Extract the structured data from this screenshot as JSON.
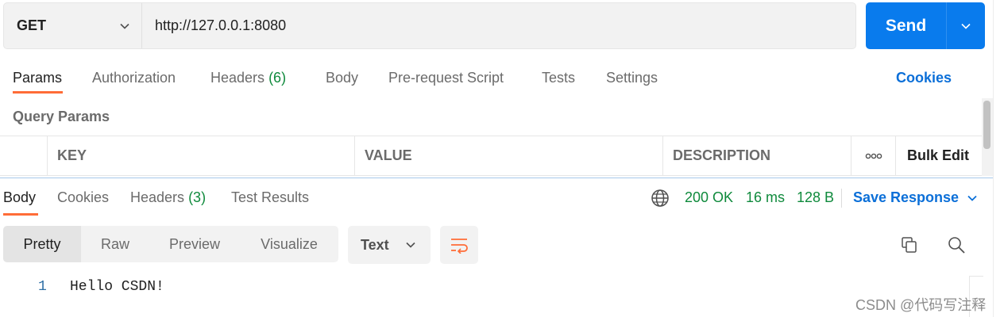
{
  "request": {
    "method": "GET",
    "url": "http://127.0.0.1:8080",
    "send_label": "Send"
  },
  "request_tabs": [
    {
      "label": "Params",
      "active": true
    },
    {
      "label": "Authorization"
    },
    {
      "label": "Headers",
      "count": "(6)"
    },
    {
      "label": "Body"
    },
    {
      "label": "Pre-request Script"
    },
    {
      "label": "Tests"
    },
    {
      "label": "Settings"
    }
  ],
  "cookies_link": "Cookies",
  "query_params": {
    "title": "Query Params",
    "columns": [
      "KEY",
      "VALUE",
      "DESCRIPTION"
    ],
    "more_icon_label": "ooo",
    "bulk_edit": "Bulk Edit"
  },
  "response_tabs": [
    {
      "label": "Body",
      "active": true
    },
    {
      "label": "Cookies"
    },
    {
      "label": "Headers",
      "count": "(3)"
    },
    {
      "label": "Test Results"
    }
  ],
  "response_status": {
    "status": "200 OK",
    "time": "16 ms",
    "size": "128 B",
    "save_label": "Save Response"
  },
  "view_modes": [
    "Pretty",
    "Raw",
    "Preview",
    "Visualize"
  ],
  "format": "Text",
  "body": {
    "line_number": "1",
    "content": "Hello CSDN!"
  },
  "watermark": "CSDN @代码写注释",
  "colors": {
    "accent": "#ff6c37",
    "send": "#097bed",
    "link": "#0b6fd8",
    "success": "#0f8a3c"
  },
  "icons": [
    "chevron-down-icon",
    "globe-icon",
    "wrap-lines-icon",
    "copy-icon",
    "search-icon"
  ]
}
